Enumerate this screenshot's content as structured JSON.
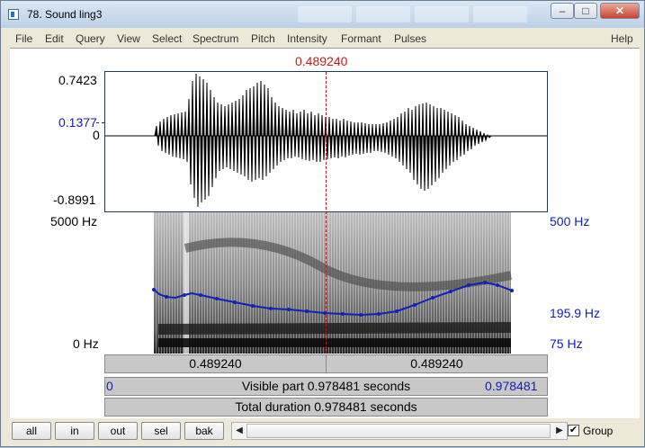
{
  "window": {
    "title": "78. Sound ling3",
    "buttons": [
      "minimize",
      "maximize",
      "close"
    ]
  },
  "menu": [
    "File",
    "Edit",
    "Query",
    "View",
    "Select",
    "Spectrum",
    "Pitch",
    "Intensity",
    "Formant",
    "Pulses"
  ],
  "menu_help": "Help",
  "cursor_time": "0.489240",
  "waveform": {
    "ymax": "0.7423",
    "cursor_value": "0.1377",
    "zero": "0",
    "ymin": "-0.8991"
  },
  "spectrogram": {
    "freq_top": "5000 Hz",
    "freq_bottom": "0 Hz"
  },
  "pitch": {
    "top": "500 Hz",
    "cursor_value": "195.9 Hz",
    "bottom": "75 Hz",
    "color": "#1020b8"
  },
  "bars": {
    "left_time": "0.489240",
    "right_time": "0.489240",
    "visible_start": "0",
    "visible_label": "Visible part 0.978481 seconds",
    "visible_end": "0.978481",
    "total_label": "Total duration 0.978481 seconds"
  },
  "bottom_buttons": [
    "all",
    "in",
    "out",
    "sel",
    "bak"
  ],
  "group": {
    "label": "Group",
    "checked": true
  }
}
